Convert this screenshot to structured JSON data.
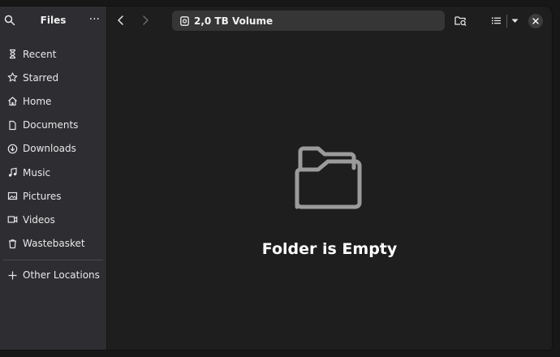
{
  "sidebar": {
    "title": "Files",
    "search_icon": "search-icon",
    "menu_icon": "more-horizontal-icon",
    "items": [
      {
        "label": "Recent",
        "icon": "hourglass-icon"
      },
      {
        "label": "Starred",
        "icon": "star-icon"
      },
      {
        "label": "Home",
        "icon": "home-icon"
      },
      {
        "label": "Documents",
        "icon": "document-icon"
      },
      {
        "label": "Downloads",
        "icon": "download-icon"
      },
      {
        "label": "Music",
        "icon": "music-icon"
      },
      {
        "label": "Pictures",
        "icon": "picture-icon"
      },
      {
        "label": "Videos",
        "icon": "video-icon"
      },
      {
        "label": "Wastebasket",
        "icon": "trash-icon"
      }
    ],
    "other": {
      "label": "Other Locations",
      "icon": "plus-icon"
    }
  },
  "toolbar": {
    "path_label": "2,0 TB Volume",
    "path_icon": "drive-icon",
    "back_icon": "chevron-left-icon",
    "forward_icon": "chevron-right-icon",
    "search_folder_icon": "folder-search-icon",
    "view_icon": "list-view-icon",
    "view_menu_icon": "caret-down-icon",
    "close_icon": "close-icon"
  },
  "main": {
    "empty_title": "Folder is Empty",
    "empty_icon": "folder-open-icon"
  },
  "colors": {
    "sidebar_bg": "#2e2e32",
    "main_bg": "#1e1e1e",
    "pathbar_bg": "#363636",
    "text": "#ffffff"
  }
}
